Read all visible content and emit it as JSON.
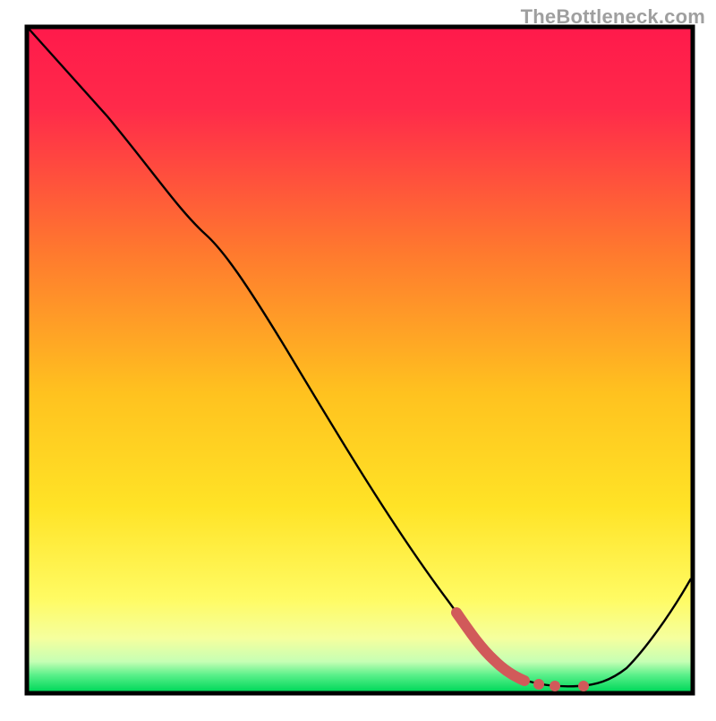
{
  "watermark": "TheBottleneck.com",
  "chart_data": {
    "type": "line",
    "title": "",
    "xlabel": "",
    "ylabel": "",
    "xlim": [
      0,
      100
    ],
    "ylim": [
      0,
      100
    ],
    "highlight": {
      "x_range": [
        68,
        82
      ],
      "note": "segment emphasized in red"
    },
    "series": [
      {
        "name": "curve",
        "x": [
          0,
          12,
          24,
          32,
          44,
          56,
          66,
          72,
          78,
          82,
          90,
          100
        ],
        "values": [
          100,
          87,
          72,
          62,
          44,
          26,
          10,
          3,
          1,
          1.5,
          9,
          20
        ]
      }
    ],
    "background_gradient": {
      "top": "#ff1a4b",
      "mid": "#ffd400",
      "bottom_band": "#00e05a"
    }
  }
}
